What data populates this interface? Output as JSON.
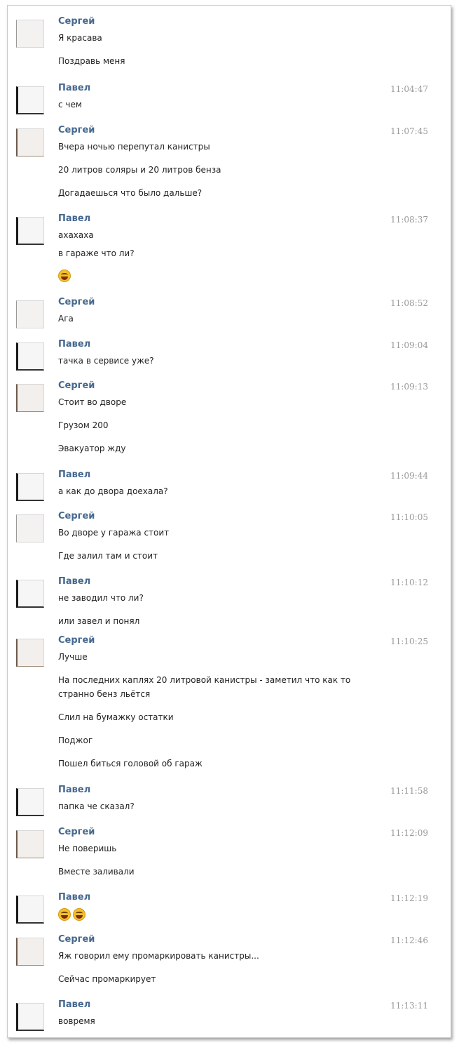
{
  "dialog": {
    "messages": [
      {
        "author": "Сергей",
        "time": "",
        "avatar": "light",
        "lines": [
          "Я красава",
          "Поздравь меня"
        ]
      },
      {
        "author": "Павел",
        "time": "11:04:47",
        "avatar": "dark",
        "lines": [
          "с чем"
        ]
      },
      {
        "author": "Сергей",
        "time": "11:07:45",
        "avatar": "brown",
        "lines": [
          "Вчера ночью перепутал канистры",
          "20 литров соляры и 20 литров бенза",
          "Догадаешься что было дальше?"
        ]
      },
      {
        "author": "Павел",
        "time": "11:08:37",
        "avatar": "dark",
        "lines": [
          "ахахаха",
          "в гараже что ли?"
        ],
        "emoji_count": 1
      },
      {
        "author": "Сергей",
        "time": "11:08:52",
        "avatar": "light",
        "lines": [
          "Ага"
        ]
      },
      {
        "author": "Павел",
        "time": "11:09:04",
        "avatar": "dark",
        "lines": [
          "тачка в сервисе уже?"
        ]
      },
      {
        "author": "Сергей",
        "time": "11:09:13",
        "avatar": "brown",
        "lines": [
          "Стоит во дворе",
          "Грузом 200",
          "Эвакуатор жду"
        ]
      },
      {
        "author": "Павел",
        "time": "11:09:44",
        "avatar": "dark",
        "lines": [
          "а как до двора доехала?"
        ]
      },
      {
        "author": "Сергей",
        "time": "11:10:05",
        "avatar": "light",
        "lines": [
          "Во дворе у гаража стоит",
          "Где залил там и стоит"
        ]
      },
      {
        "author": "Павел",
        "time": "11:10:12",
        "avatar": "dark",
        "lines": [
          "не заводил что ли?",
          "или завел и понял"
        ]
      },
      {
        "author": "Сергей",
        "time": "11:10:25",
        "avatar": "brown",
        "lines": [
          "Лучше",
          "На последних каплях 20 литровой канистры - заметил что как то",
          "странно бенз льётся",
          "Слил на бумажку остатки",
          "Поджог",
          "Пошел биться головой об гараж"
        ]
      },
      {
        "author": "Павел",
        "time": "11:11:58",
        "avatar": "dark",
        "lines": [
          "папка че сказал?"
        ]
      },
      {
        "author": "Сергей",
        "time": "11:12:09",
        "avatar": "brown",
        "lines": [
          "Не поверишь",
          "Вместе заливали"
        ]
      },
      {
        "author": "Павел",
        "time": "11:12:19",
        "avatar": "dark",
        "lines": [],
        "emoji_count": 2
      },
      {
        "author": "Сергей",
        "time": "11:12:46",
        "avatar": "brown",
        "lines": [
          "Яж говорил ему промаркировать канистры...",
          "Сейчас промаркирует"
        ]
      },
      {
        "author": "Павел",
        "time": "11:13:11",
        "avatar": "dark",
        "lines": [
          "вовремя"
        ]
      }
    ]
  }
}
